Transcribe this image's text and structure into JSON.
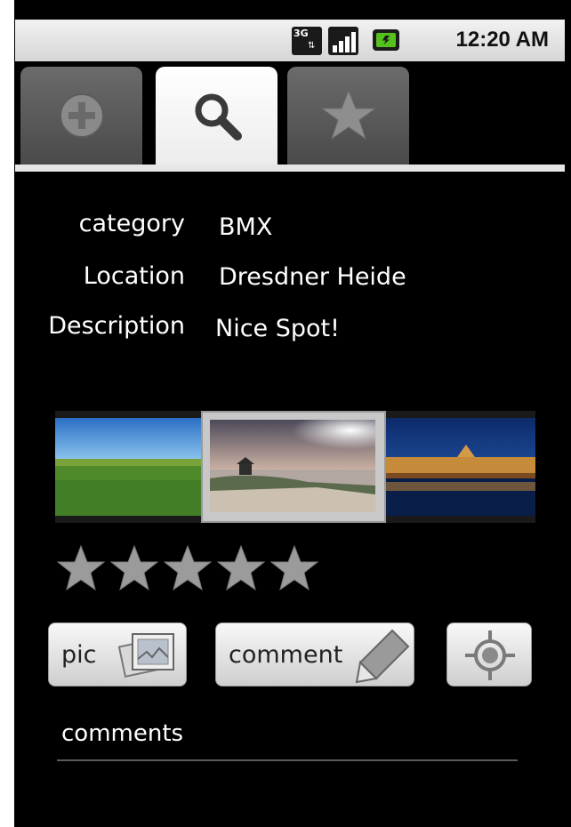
{
  "status_bar": {
    "network_type": "3G",
    "network_icon": "3g-data-icon",
    "signal_icon": "signal-strength-icon",
    "battery_icon": "battery-charging-icon",
    "time": "12:20 AM"
  },
  "tabs": [
    {
      "icon": "add-circle-icon",
      "active": false
    },
    {
      "icon": "search-magnifier-icon",
      "active": true
    },
    {
      "icon": "star-icon",
      "active": false
    }
  ],
  "details": {
    "category_label": "category",
    "category_value": "BMX",
    "location_label": "Location",
    "location_value": "Dresdner Heide",
    "description_label": "Description",
    "description_value": "Nice Spot!"
  },
  "gallery": {
    "images": [
      "meadow-photo",
      "lake-sunset-photo",
      "night-palace-photo"
    ],
    "selected_index": 1
  },
  "rating": {
    "stars_total": 5,
    "stars_filled": 0
  },
  "buttons": {
    "pic_label": "pic",
    "comment_label": "comment",
    "locate_icon": "gps-target-icon"
  },
  "comments": {
    "title": "comments"
  },
  "colors": {
    "background": "#000000",
    "tab_active": "#ffffff",
    "tab_inactive": "#5a5a5a",
    "battery": "#55c21c"
  }
}
